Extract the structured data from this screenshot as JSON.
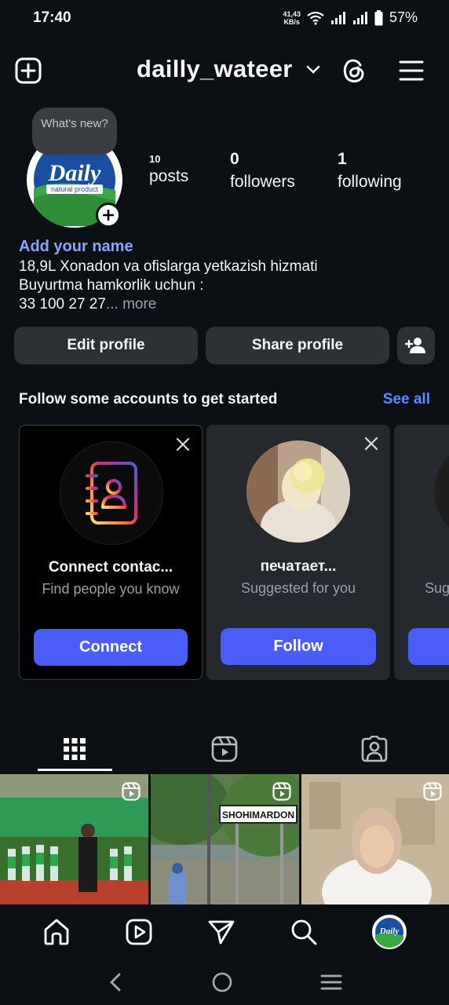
{
  "status": {
    "time": "17:40",
    "net_speed_top": "41,43",
    "net_speed_bottom": "KB/s",
    "battery": "57%"
  },
  "header": {
    "username": "dailly_wateer",
    "icons": [
      "add-post-icon",
      "chevron-down-icon",
      "threads-icon",
      "menu-icon"
    ]
  },
  "profile": {
    "note_text": "What's new?",
    "avatar_logo_main": "Daily",
    "avatar_logo_sub": "natural product",
    "stats": [
      {
        "value": "10",
        "label": "posts"
      },
      {
        "value": "0",
        "label": "followers"
      },
      {
        "value": "1",
        "label": "following"
      }
    ],
    "add_name": "Add your name",
    "bio_line1": "18,9L Xonadon va ofislarga yetkazish hizmati",
    "bio_line2": "Buyurtma hamkorlik uchun :",
    "bio_line3": "33 100 27 27",
    "bio_ellipsis": "...",
    "bio_more": " more"
  },
  "actions": {
    "edit_profile": "Edit profile",
    "share_profile": "Share profile"
  },
  "suggestions": {
    "title": "Follow some accounts to get started",
    "see_all": "See all",
    "cards": [
      {
        "title": "Connect contac...",
        "subtitle": "Find people you know",
        "button": "Connect"
      },
      {
        "title": "печатает...",
        "subtitle": "Suggested for you",
        "button": "Follow"
      },
      {
        "title": "",
        "subtitle": "Sug",
        "button": ""
      }
    ]
  },
  "posts_grid": {
    "items": [
      {
        "sign_text": ""
      },
      {
        "sign_text": "SHOHIMARDON"
      },
      {
        "sign_text": ""
      }
    ]
  },
  "colors": {
    "background": "#0c1014",
    "accent": "#4a5df9",
    "link": "#8aa4ff",
    "see_all": "#5b8cff"
  }
}
